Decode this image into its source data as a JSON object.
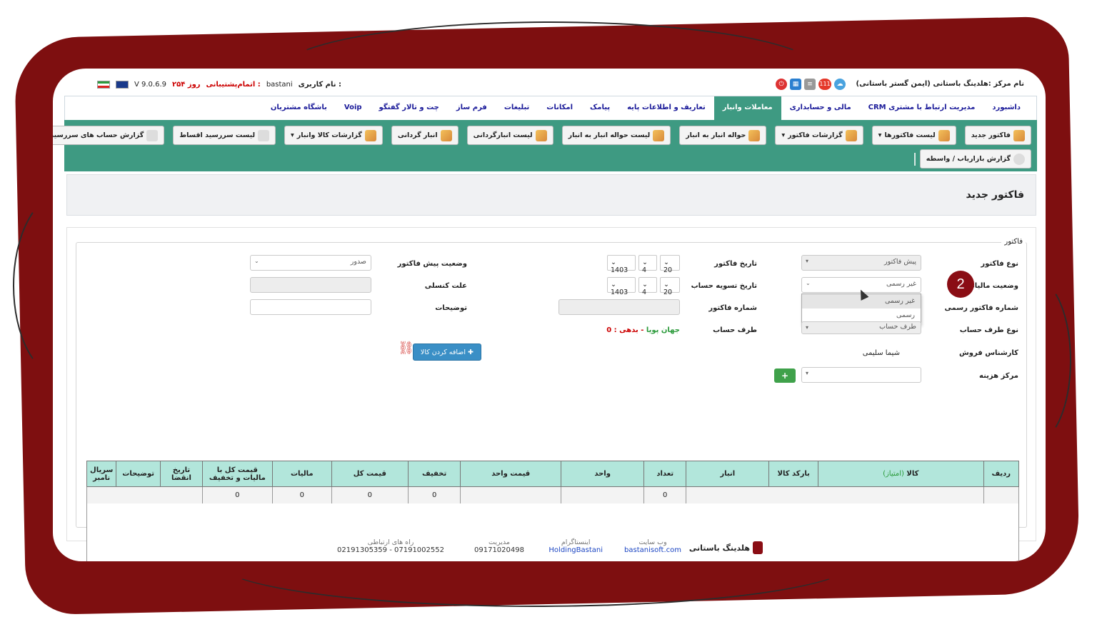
{
  "topbar": {
    "center_name": "نام مرکز :هلدینگ باستانی (ایمن گستر باستانی)",
    "notification_count": "111",
    "version": "V 9.0.6.9",
    "support_label": "اتمام‌پشتیبانی :",
    "support_days": "۲۵۴ روز",
    "username_label": "نام کاربری :",
    "username": "bastani"
  },
  "menu": [
    {
      "label": "داشبورد"
    },
    {
      "label": "مدیریت ارتباط با مشتری CRM"
    },
    {
      "label": "مالی و حسابداری"
    },
    {
      "label": "معاملات وانبار",
      "active": true
    },
    {
      "label": "تعاریف و اطلاعات پایه"
    },
    {
      "label": "پیامک"
    },
    {
      "label": "امکانات"
    },
    {
      "label": "تبلیغات"
    },
    {
      "label": "فرم ساز"
    },
    {
      "label": "چت و تالار گفتگو"
    },
    {
      "label": "Voip"
    },
    {
      "label": "باشگاه مشتریان"
    }
  ],
  "toolbar": {
    "row1": [
      {
        "label": "فاکتور جدید"
      },
      {
        "label": "لیست فاکتورها",
        "dropdown": true
      },
      {
        "label": "گزارشات فاکتور",
        "dropdown": true
      },
      {
        "label": "حواله انبار به انبار"
      },
      {
        "label": "لیست حواله انبار به انبار"
      },
      {
        "label": "لیست انبارگردانی"
      },
      {
        "label": "انبار گردانی"
      },
      {
        "label": "گزارشات کالا وانبار",
        "dropdown": true
      },
      {
        "label": "لیست سررسید اقساط"
      },
      {
        "label": "گزارش حساب های سررسید شده"
      }
    ],
    "row2": [
      {
        "label": "گزارش بازاریاب / واسطه"
      }
    ]
  },
  "page": {
    "title": "فاکتور جدید",
    "legend": "فاکتور"
  },
  "form": {
    "invoice_type_label": "نوع فاکتور",
    "invoice_type_value": "پیش فاکتور",
    "tax_status_label": "وضعیت مالیاتی",
    "tax_status_value": "غیر رسمی",
    "tax_options": [
      "غیر رسمی",
      "رسمی"
    ],
    "official_number_label": "شماره فاکتور رسمی",
    "party_type_label": "نوع طرف حساب",
    "party_type_value": "طرف حساب",
    "sales_expert_label": "کارشناس فروش",
    "sales_expert_value": "شیما سلیمی",
    "cost_center_label": "مرکز هزینه",
    "invoice_date_label": "تاریخ فاکتور",
    "invoice_date": {
      "day": "20",
      "month": "4",
      "year": "1403"
    },
    "settle_date_label": "تاریخ تسویه حساب",
    "settle_date": {
      "day": "20",
      "month": "4",
      "year": "1403"
    },
    "invoice_number_label": "شماره فاکتور",
    "account_party_label": "طرف حساب",
    "account_party_name": "جهان پویا",
    "debt_text": "- بدهی : 0",
    "prefactor_status_label": "وضعیت پیش فاکتور",
    "prefactor_status_value": "صدور",
    "cancel_reason_label": "علت کنسلی",
    "description_label": "توضیحات",
    "add_goods_button": "اضافه کردن کالا",
    "plus_label": "+"
  },
  "step_badge": "2",
  "grid": {
    "headers": [
      "ردیف",
      "کالا",
      "(امتیاز)",
      "بارکد کالا",
      "انبار",
      "تعداد",
      "واحد",
      "قیمت واحد",
      "تخفیف",
      "قیمت کل",
      "مالیات",
      "قیمت کل با مالیات و تخفیف",
      "تاریخ انقضا",
      "توضیحات",
      "سریال نامبر"
    ],
    "totals": {
      "count": "0",
      "discount": "0",
      "total": "0",
      "tax": "0",
      "total_with_tax": "0"
    }
  },
  "footer": {
    "brand": "هلدینگ باستانی",
    "website_title": "وب سایت",
    "website": "bastanisoft.com",
    "instagram_title": "اینستاگرام",
    "instagram": "HoldingBastani",
    "manager_title": "مدیریت",
    "manager_phone": "09171020498",
    "contacts_title": "راه های ارتباطی",
    "contacts": "07191002552 - 02191305359"
  },
  "colors": {
    "accent": "#3e9a82",
    "frame": "#7e0f10",
    "header_row": "#b2e6db",
    "badge": "#8a0d14"
  }
}
